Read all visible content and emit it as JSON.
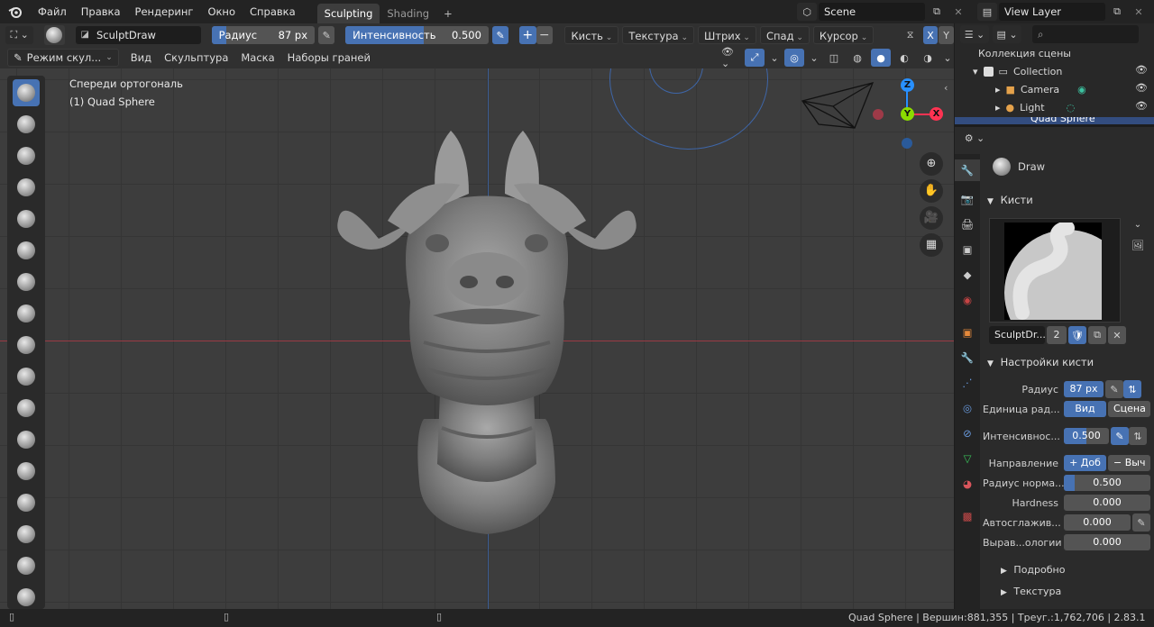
{
  "topbar": {
    "menus": [
      "Файл",
      "Правка",
      "Рендеринг",
      "Окно",
      "Справка"
    ],
    "tabs": [
      "Sculpting",
      "Shading"
    ],
    "active_tab": "Sculpting",
    "add_tab": "+",
    "scene": "Scene",
    "view_layer": "View Layer"
  },
  "toolheader": {
    "brush_name": "SculptDraw",
    "radius_label": "Радиус",
    "radius_value": "87 px",
    "strength_label": "Интенсивность",
    "strength_value": "0.500",
    "strength_fraction": 0.5,
    "plus": "+",
    "minus": "−",
    "menus": [
      "Кисть",
      "Текстура",
      "Штрих",
      "Спад",
      "Курсор"
    ],
    "axis_x": "X",
    "axis_y": "Y"
  },
  "viewport_header": {
    "mode": "Режим скул...",
    "menus": [
      "Вид",
      "Скульптура",
      "Маска",
      "Наборы граней"
    ]
  },
  "viewport": {
    "view_name": "Спереди ортогональ",
    "object_name": "(1) Quad Sphere",
    "gizmo": {
      "z": "Z",
      "y": "Y",
      "x": "X"
    }
  },
  "outliner": {
    "search_placeholder": "",
    "root": "Коллекция сцены",
    "items": [
      "Collection",
      "Camera",
      "Light",
      "Quad Sphere"
    ]
  },
  "properties": {
    "tool_name": "Draw",
    "brushes_section": "Кисти",
    "brush_datablock": "SculptDr...",
    "brush_users": "2",
    "brush_settings_section": "Настройки кисти",
    "rows": [
      {
        "label": "Радиус",
        "value": "87 px"
      },
      {
        "label": "Единица рад...",
        "value": ""
      },
      {
        "label": "Интенсивнос...",
        "value": "0.500"
      },
      {
        "label": "Направление",
        "value": ""
      },
      {
        "label": "Радиус норма...",
        "value": "0.500"
      },
      {
        "label": "Hardness",
        "value": "0.000"
      },
      {
        "label": "Автосглажив...",
        "value": "0.000"
      },
      {
        "label": "Вырав...ологии",
        "value": "0.000"
      }
    ],
    "radius_unit_options": [
      "Вид",
      "Сцена"
    ],
    "direction_options": [
      "+ Доб",
      "− Выч"
    ],
    "subpanels": [
      "Подробно",
      "Текстура"
    ]
  },
  "statusbar": {
    "info": "Quad Sphere | Вершин:881,355 | Треуг.:1,762,706 | 2.83.1"
  },
  "colors": {
    "accent": "#4772b3",
    "axis_x": "#ff3352",
    "axis_y": "#8bdc00",
    "axis_z": "#2890ff"
  }
}
